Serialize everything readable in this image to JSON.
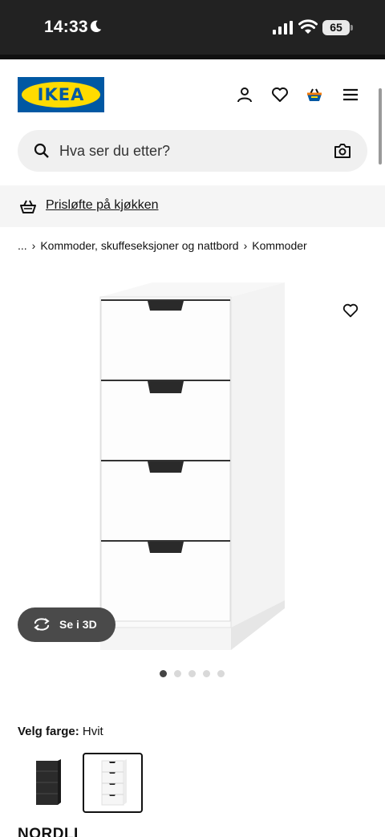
{
  "status_bar": {
    "time": "14:33",
    "battery": "65"
  },
  "logo": {
    "text": "IKEA"
  },
  "header": {
    "icons": [
      "profile-icon",
      "heart-icon",
      "basket-icon",
      "menu-icon"
    ]
  },
  "search": {
    "placeholder": "Hva ser du etter?"
  },
  "promo": {
    "text": "Prisløfte på kjøkken"
  },
  "breadcrumb": {
    "items": [
      "...",
      "Kommoder, skuffeseksjoner og nattbord",
      "Kommoder"
    ]
  },
  "gallery": {
    "see_3d_label": "Se i 3D",
    "dot_count": 5,
    "active_dot": 1
  },
  "color": {
    "label": "Velg farge:",
    "value": "Hvit",
    "options": [
      "black",
      "white"
    ],
    "selected": "white"
  },
  "product": {
    "name": "NORDLI"
  },
  "colors": {
    "ikea_blue": "#0058a3",
    "ikea_yellow": "#ffdb00",
    "basket_orange": "#f27a0a"
  }
}
